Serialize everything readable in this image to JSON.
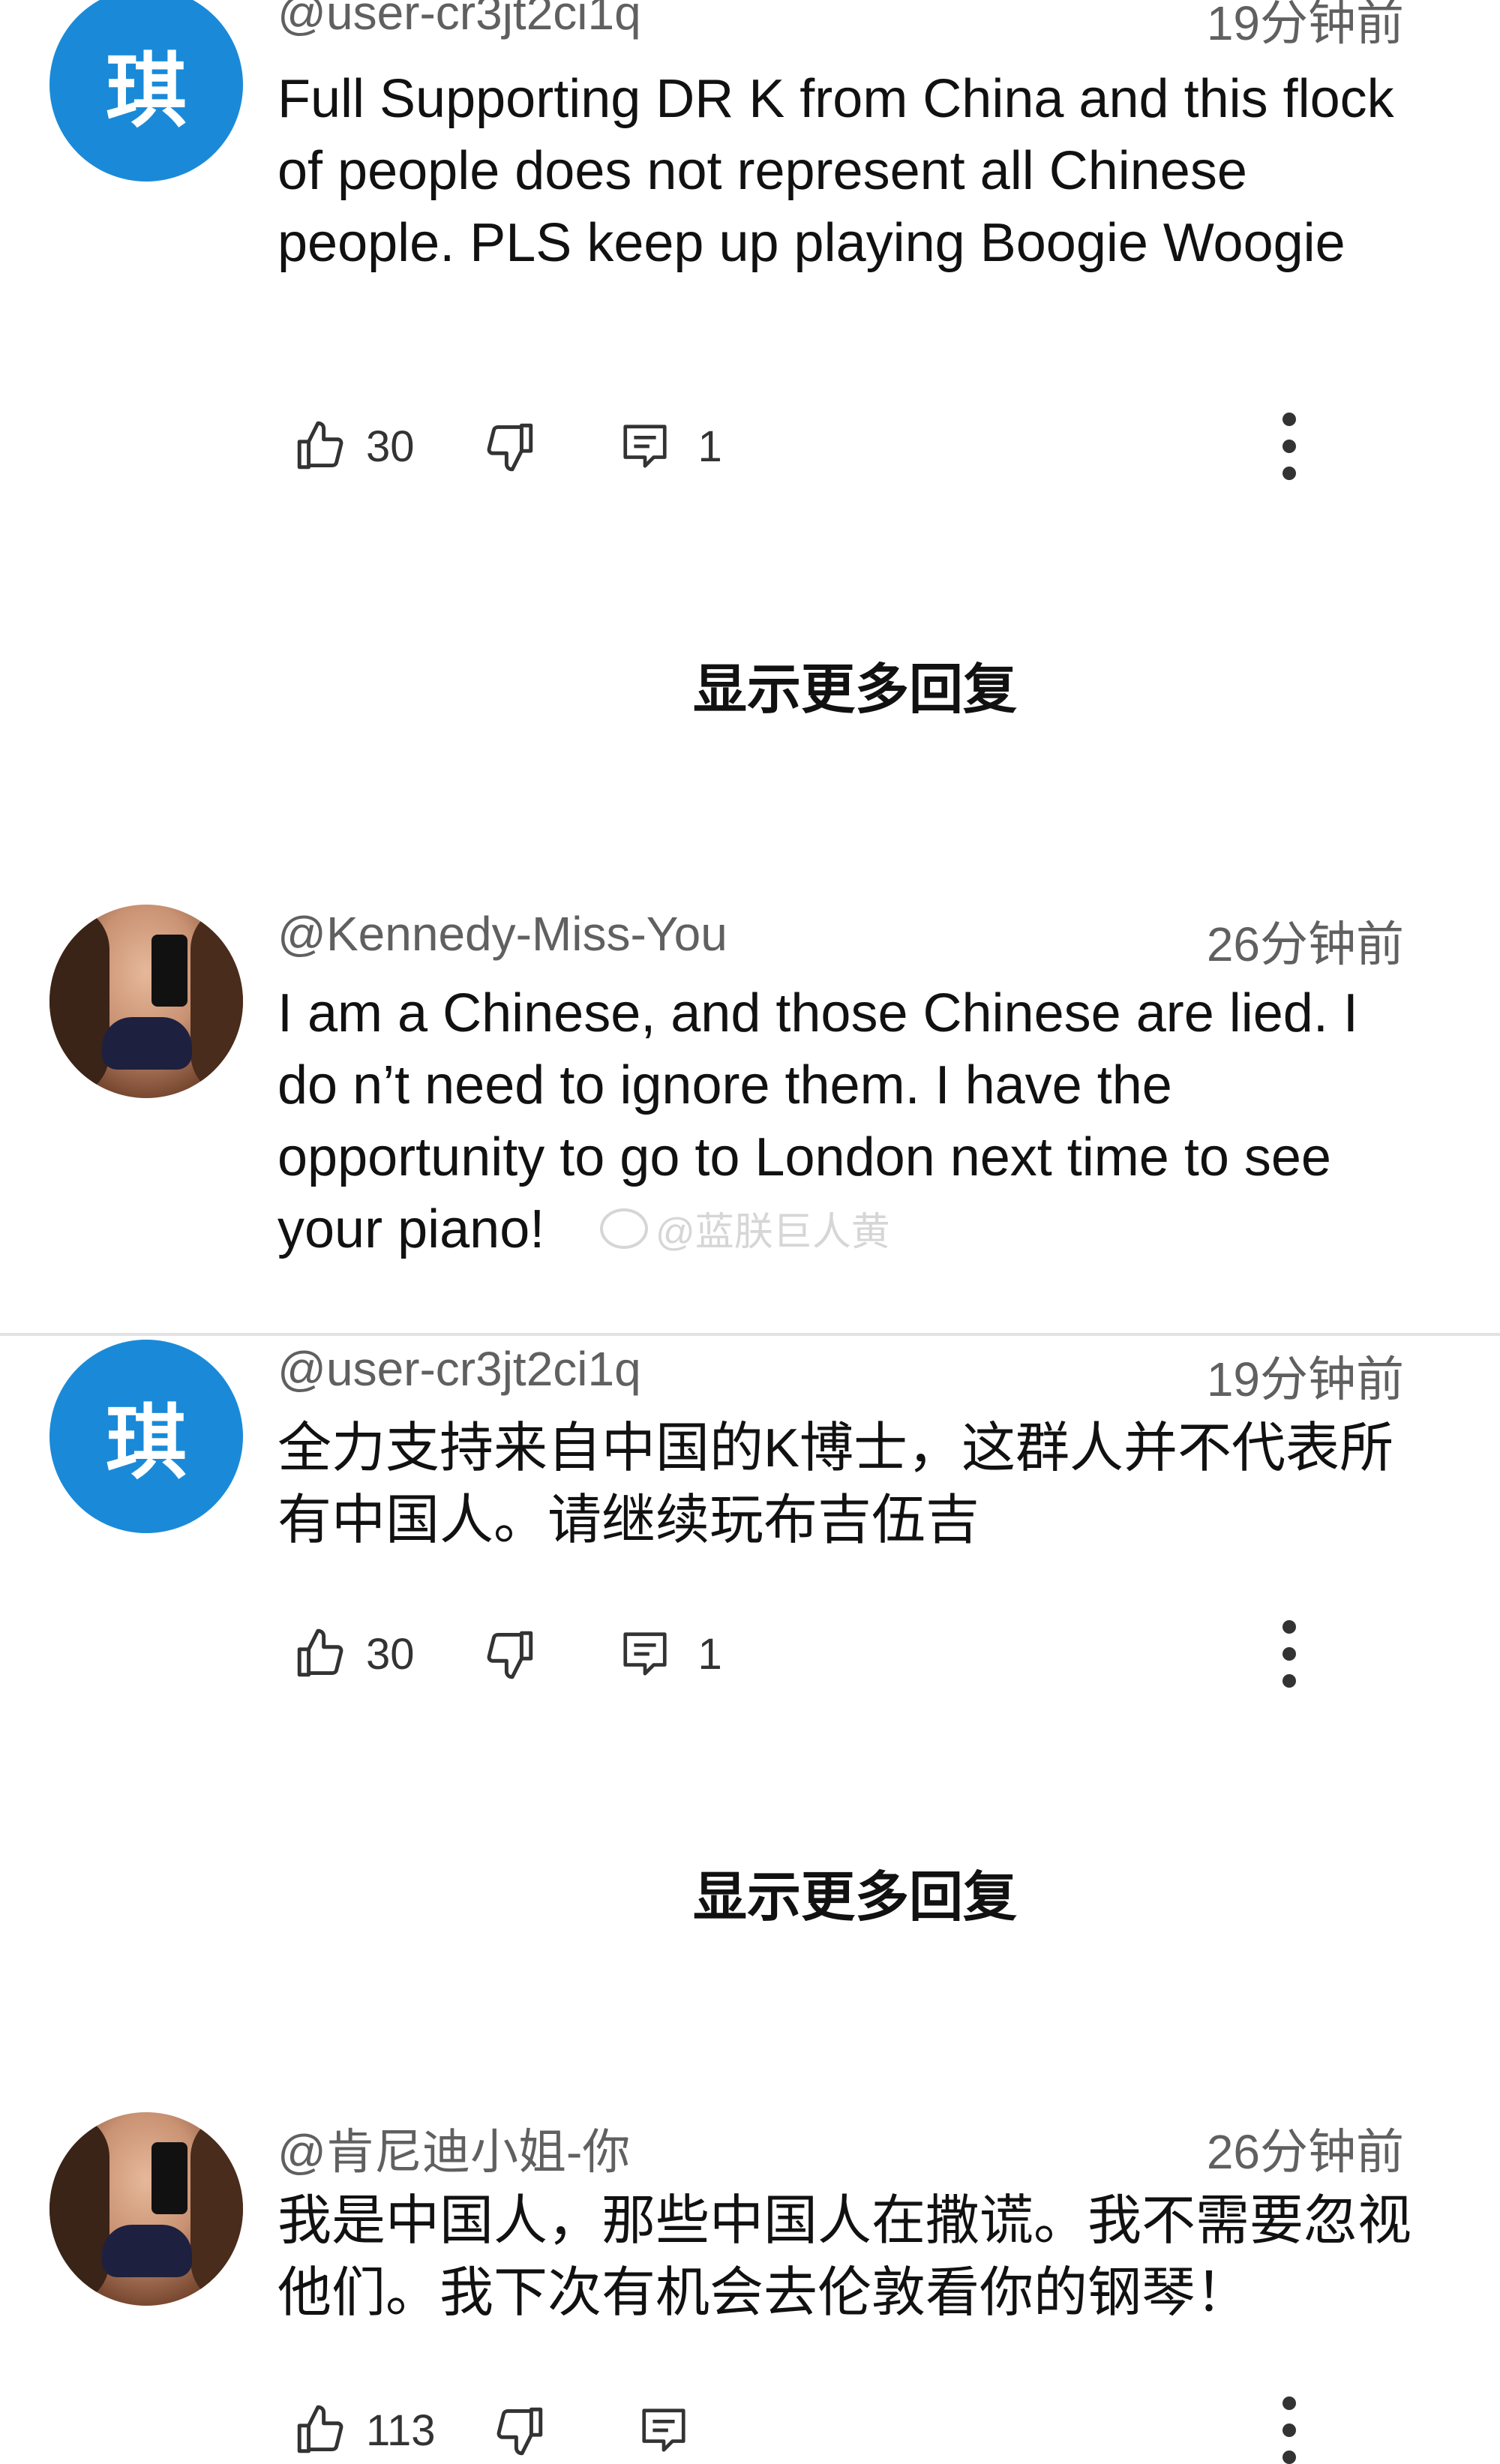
{
  "comments": [
    {
      "username": "@user-cr3jt2ci1q",
      "timestamp": "19分钟前",
      "avatar_char": "琪",
      "text": "Full Supporting DR K from China and this flock of people does not represent all Chinese people. PLS keep up playing Boogie Woogie",
      "likes": "30",
      "replies": "1"
    },
    {
      "username": "@Kennedy-Miss-You",
      "timestamp": "26分钟前",
      "text": "I am a Chinese, and those Chinese are lied. I do n’t need to ignore them. I have the opportunity to go to London next time to see your piano!"
    },
    {
      "username": "@user-cr3jt2ci1q",
      "timestamp": "19分钟前",
      "avatar_char": "琪",
      "text": "全力支持来自中国的K博士，这群人并不代表所有中国人。请继续玩布吉伍吉",
      "likes": "30",
      "replies": "1"
    },
    {
      "username": "@肯尼迪小姐-你",
      "timestamp": "26分钟前",
      "text": "我是中国人，那些中国人在撒谎。我不需要忽视他们。我下次有机会去伦敦看你的钢琴！",
      "likes": "113"
    }
  ],
  "show_more_replies": "显示更多回复",
  "watermark": "@蓝朕巨人黄",
  "icons": [
    "like-icon",
    "dislike-icon",
    "reply-icon",
    "more-options-icon",
    "weibo-icon"
  ],
  "colors": {
    "avatar_blue": "#1a8ad8",
    "secondary_text": "#606060"
  }
}
